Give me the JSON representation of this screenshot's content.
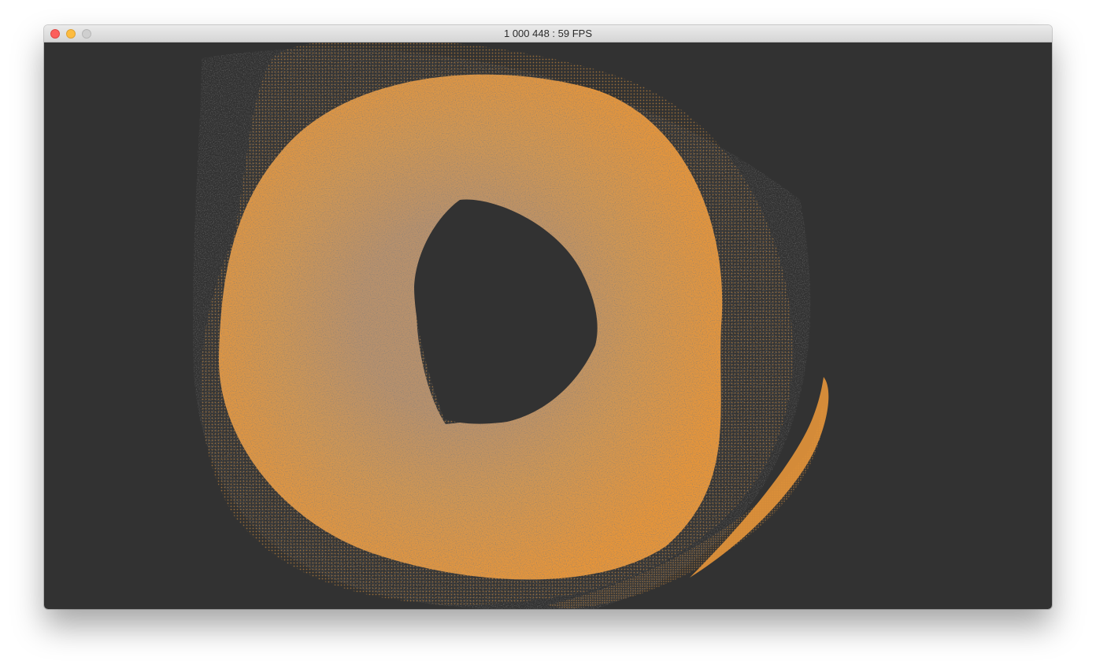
{
  "window": {
    "title": "1 000 448 : 59 FPS"
  },
  "canvas": {
    "background_color": "#323232",
    "particle_color_outer": "#e6953a",
    "particle_color_inner": "#b9926a",
    "content": "particle-attractor-visualization"
  },
  "icons": {
    "close": "close-button-icon",
    "minimize": "minimize-button-icon",
    "zoom": "zoom-button-icon"
  }
}
